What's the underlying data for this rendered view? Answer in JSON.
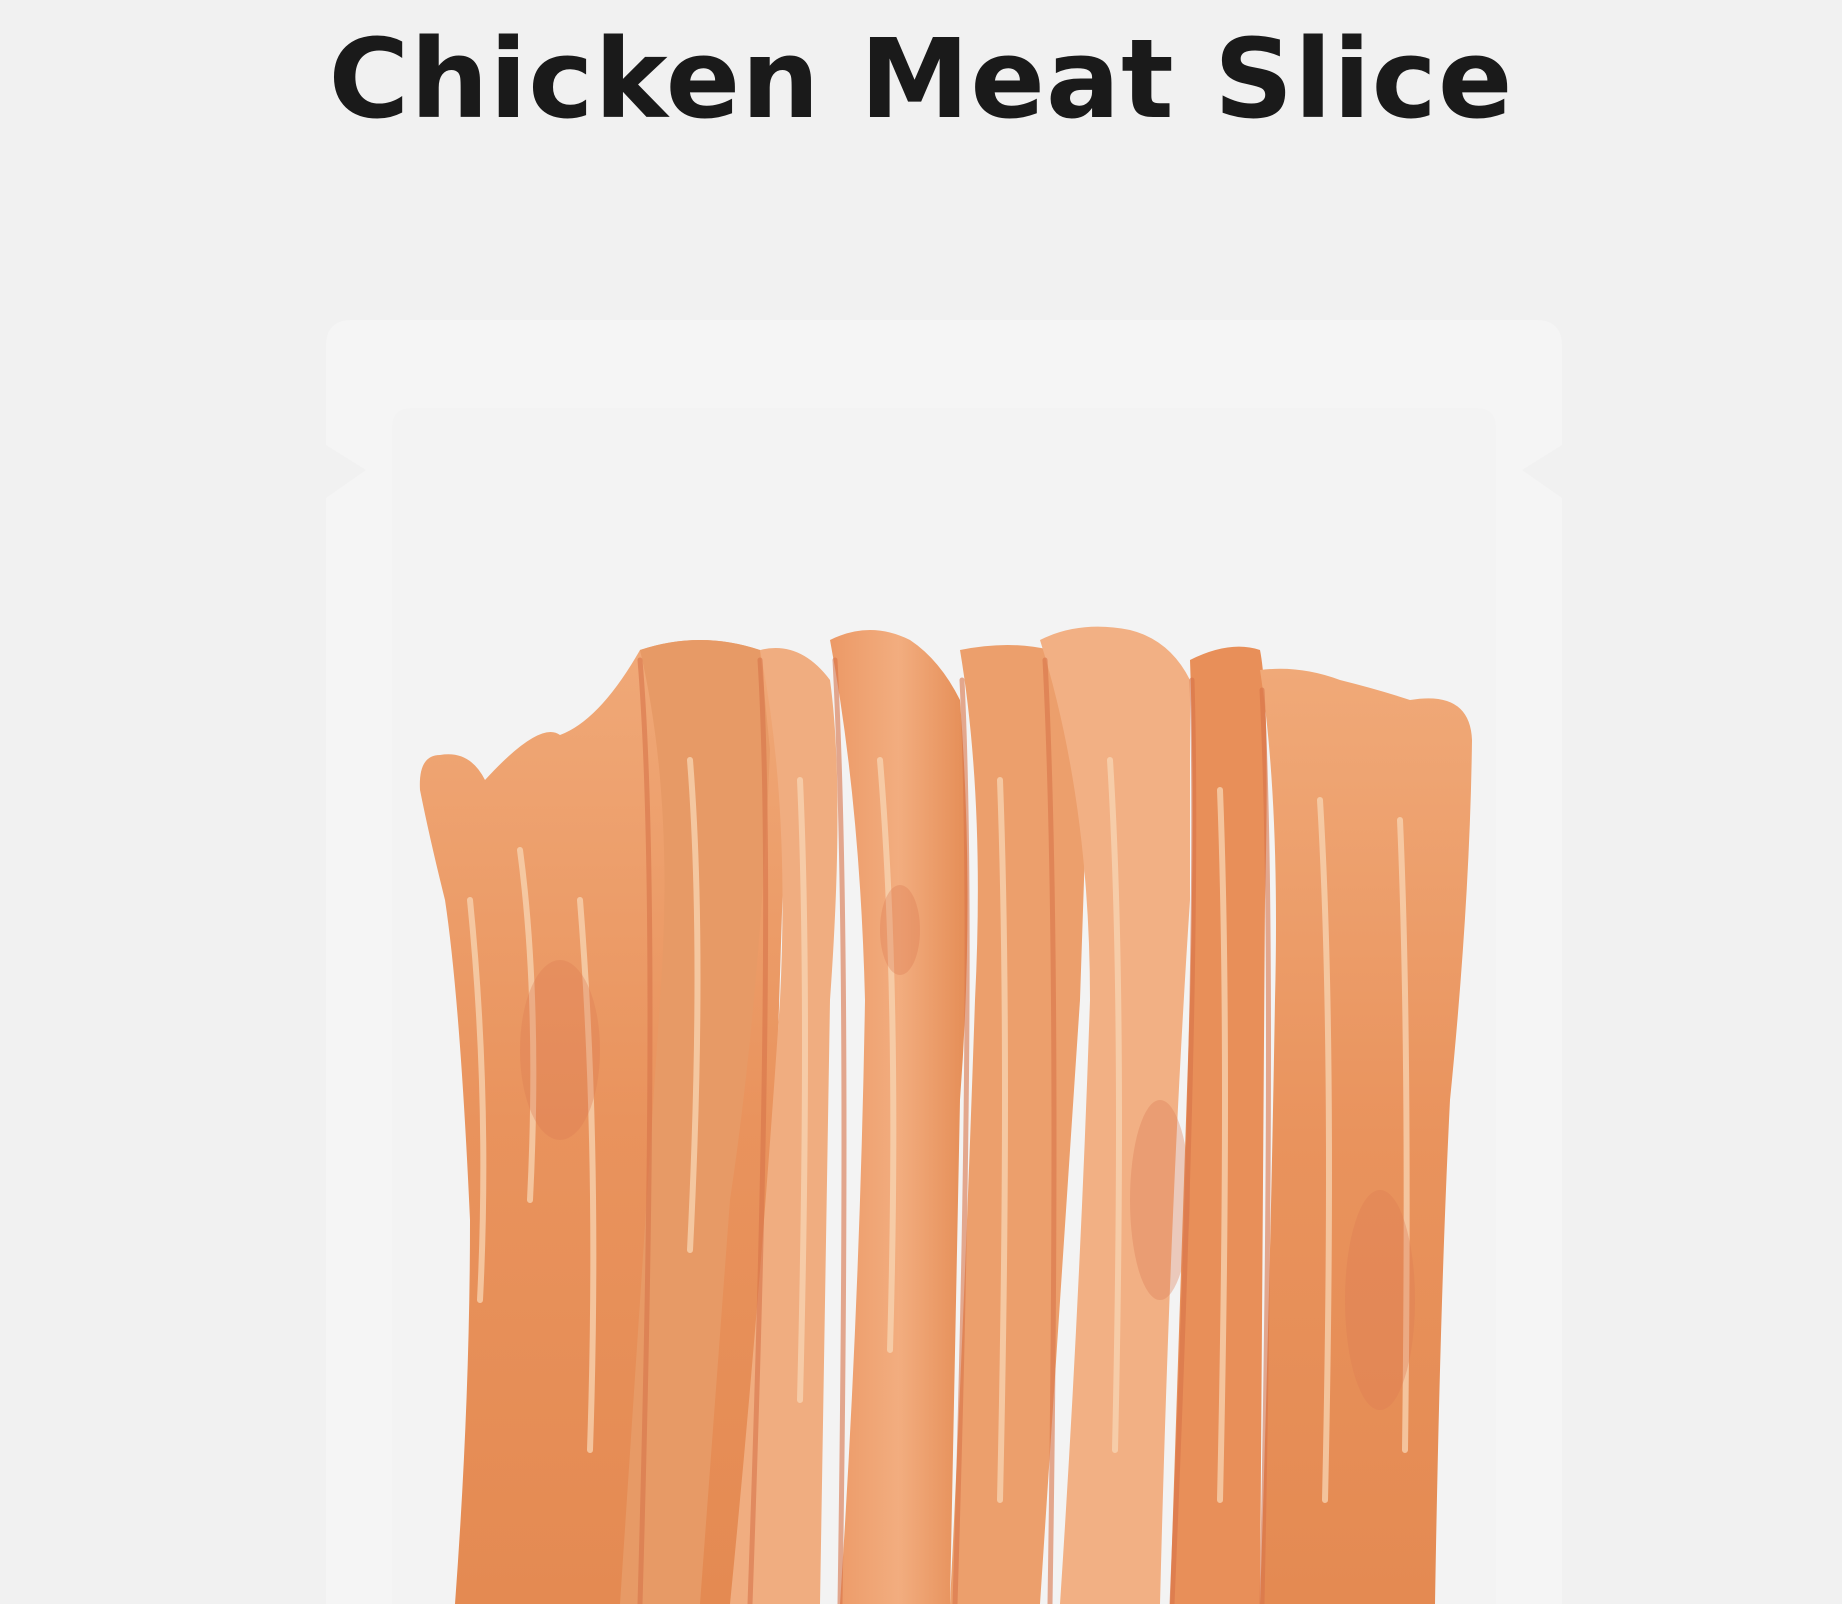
{
  "product": {
    "title": "Chicken Meat Slice",
    "image_label": "chicken-meat-slice-photo"
  },
  "colors": {
    "background": "#f1f1f1",
    "package": "#f5f5f5",
    "inner_panel": "#f3f3f3",
    "title_text": "#1a1a1a",
    "meat_base": "#e9955f",
    "meat_light": "#f3b585",
    "meat_dark": "#d9794a",
    "meat_fat": "#f8d8b6"
  }
}
